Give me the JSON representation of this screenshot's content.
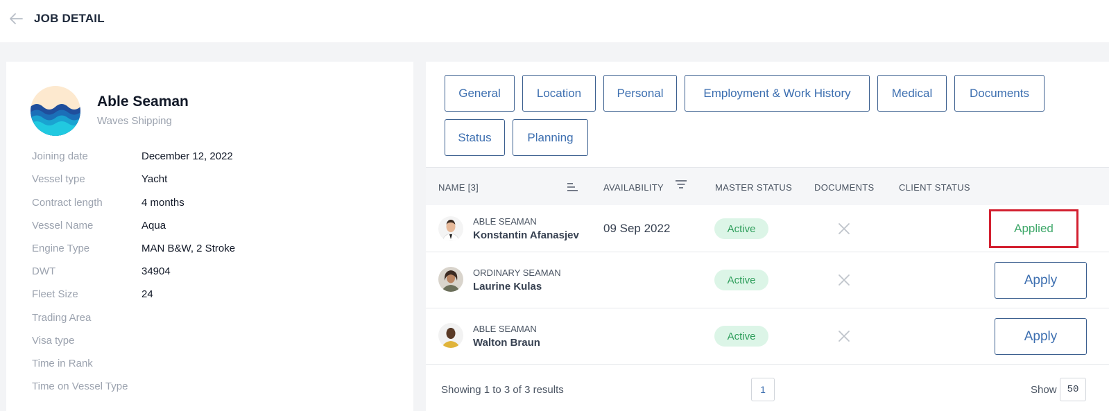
{
  "header": {
    "title": "JOB DETAIL"
  },
  "job": {
    "title": "Able Seaman",
    "company": "Waves Shipping",
    "details": [
      {
        "label": "Joining date",
        "value": "December 12, 2022"
      },
      {
        "label": "Vessel type",
        "value": "Yacht"
      },
      {
        "label": "Contract length",
        "value": "4 months"
      },
      {
        "label": "Vessel Name",
        "value": "Aqua"
      },
      {
        "label": "Engine Type",
        "value": "MAN B&W, 2 Stroke"
      },
      {
        "label": "DWT",
        "value": "34904"
      },
      {
        "label": "Fleet Size",
        "value": "24"
      },
      {
        "label": "Trading Area",
        "value": ""
      },
      {
        "label": "Visa type",
        "value": ""
      },
      {
        "label": "Time in Rank",
        "value": ""
      },
      {
        "label": "Time on Vessel Type",
        "value": ""
      }
    ]
  },
  "tabs": [
    "General",
    "Location",
    "Personal",
    "Employment & Work History",
    "Medical",
    "Documents",
    "Status",
    "Planning"
  ],
  "table": {
    "headers": {
      "name": "NAME [3]",
      "availability": "AVAILABILITY",
      "master_status": "MASTER STATUS",
      "documents": "DOCUMENTS",
      "client_status": "CLIENT STATUS"
    },
    "rows": [
      {
        "rank": "ABLE SEAMAN",
        "name": "Konstantin Afanasjev",
        "availability": "09 Sep 2022",
        "master_status": "Active",
        "action": "Applied"
      },
      {
        "rank": "ORDINARY SEAMAN",
        "name": "Laurine Kulas",
        "availability": "",
        "master_status": "Active",
        "action": "Apply"
      },
      {
        "rank": "ABLE SEAMAN",
        "name": "Walton Braun",
        "availability": "",
        "master_status": "Active",
        "action": "Apply"
      }
    ]
  },
  "footer": {
    "results_text": "Showing 1 to 3 of 3 results",
    "current_page": "1",
    "show_label": "Show",
    "page_size": "50"
  },
  "colors": {
    "accent": "#3d6fb0",
    "active_badge_bg": "#dcf5e7",
    "active_badge_text": "#2e9e5b",
    "highlight_border": "#d32030"
  }
}
